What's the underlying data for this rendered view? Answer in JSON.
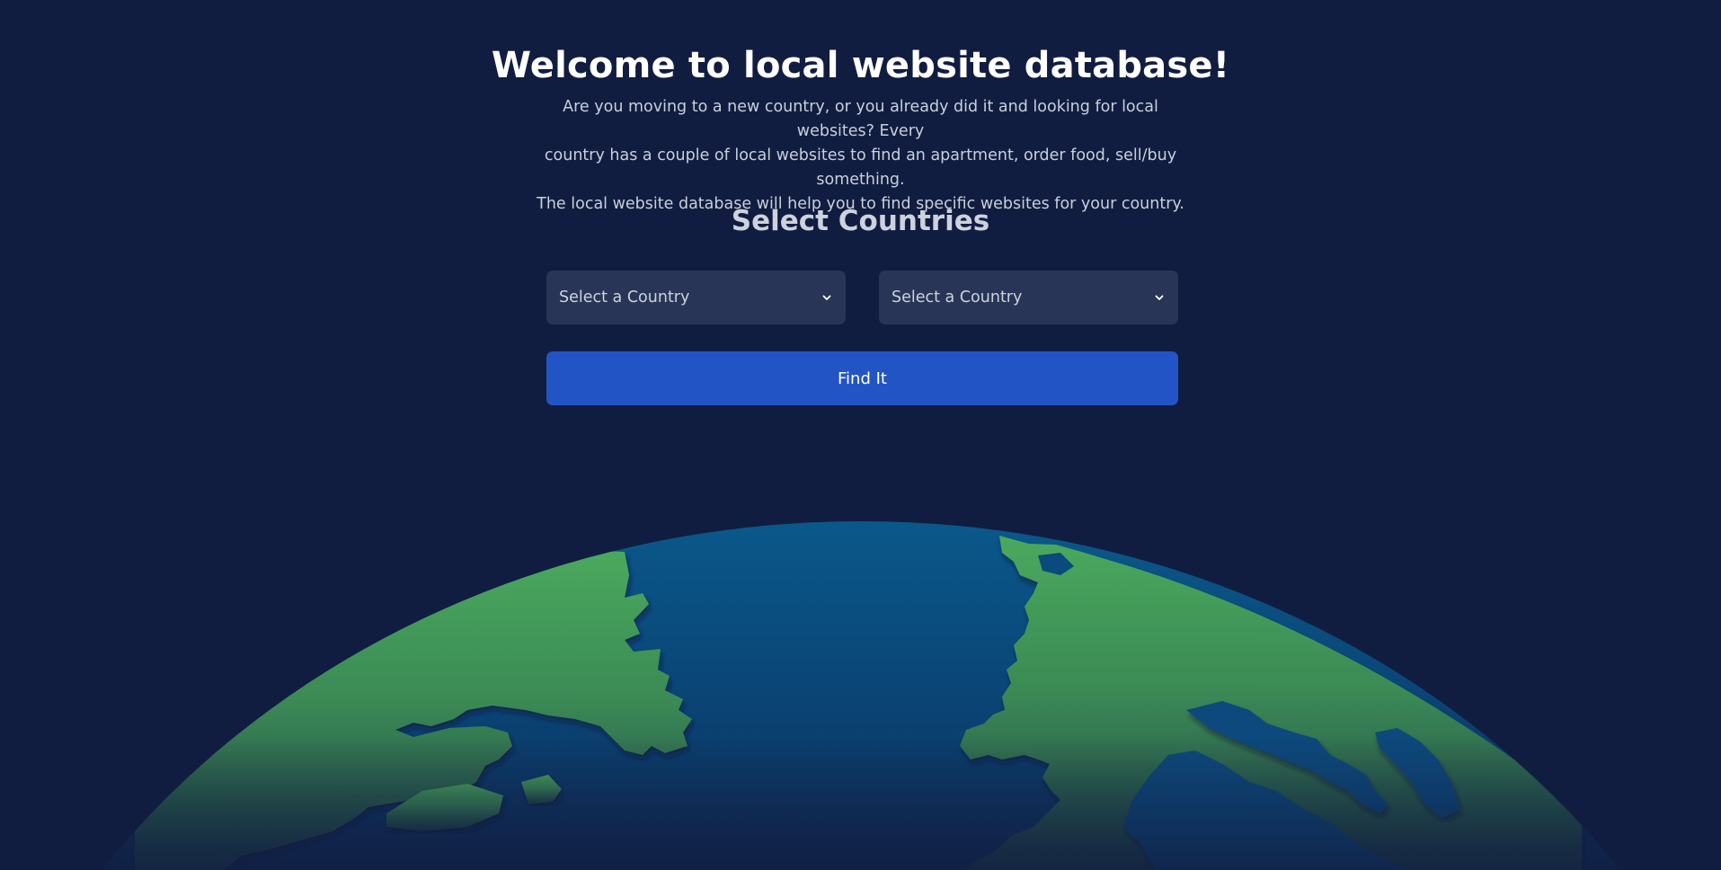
{
  "header": {
    "title": "Welcome to local website database!",
    "intro_lines": [
      "Are you moving to a new country, or you already did it and looking for local websites? Every",
      "country has a couple of local websites to find an apartment, order food, sell/buy something.",
      "The local website database will help you to find specific websites for your country."
    ]
  },
  "selector": {
    "heading": "Select Countries",
    "first": {
      "placeholder": "Select a Country"
    },
    "second": {
      "placeholder": "Select a Country"
    },
    "button_label": "Find It"
  },
  "colors": {
    "background": "#111d40",
    "select_bg": "#293556",
    "button_bg": "#2354c5",
    "ocean": "#0a5282",
    "land": "#45a058"
  },
  "icons": {
    "select_chevron": "chevron-down-icon",
    "illustration": "globe-illustration"
  }
}
